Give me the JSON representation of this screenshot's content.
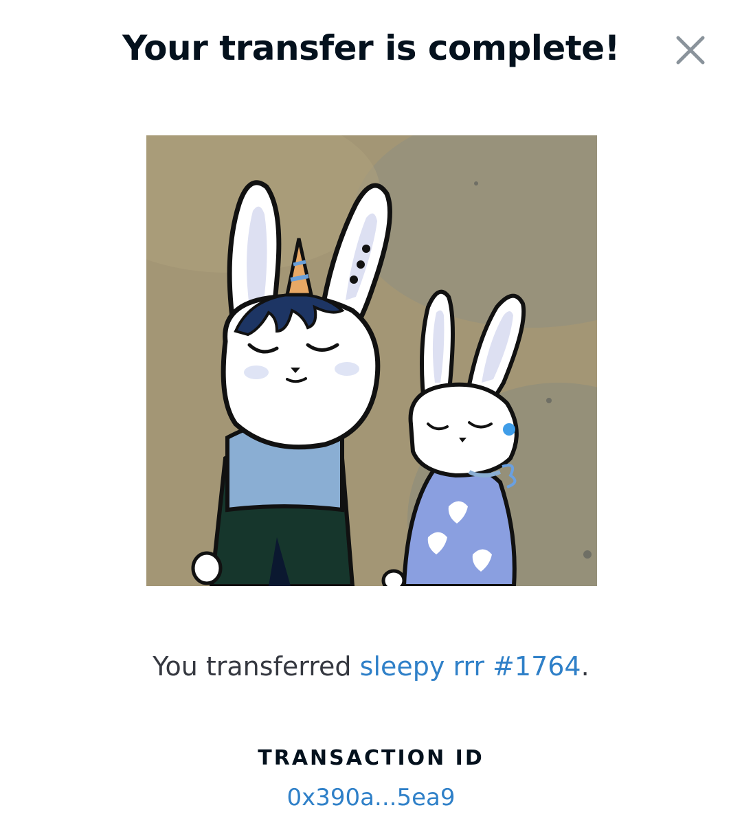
{
  "modal": {
    "title": "Your transfer is complete!",
    "close_icon": "close-icon"
  },
  "nft": {
    "image_description_icon": "nft-artwork",
    "prefix_text": "You transferred ",
    "name": "sleepy rrr #1764",
    "suffix_text": "."
  },
  "transaction": {
    "label": "TRANSACTION ID",
    "id": "0x390a...5ea9"
  },
  "colors": {
    "title": "#04111d",
    "link": "#2f80c8",
    "body_text": "#353840",
    "close_icon": "#8a939b"
  }
}
